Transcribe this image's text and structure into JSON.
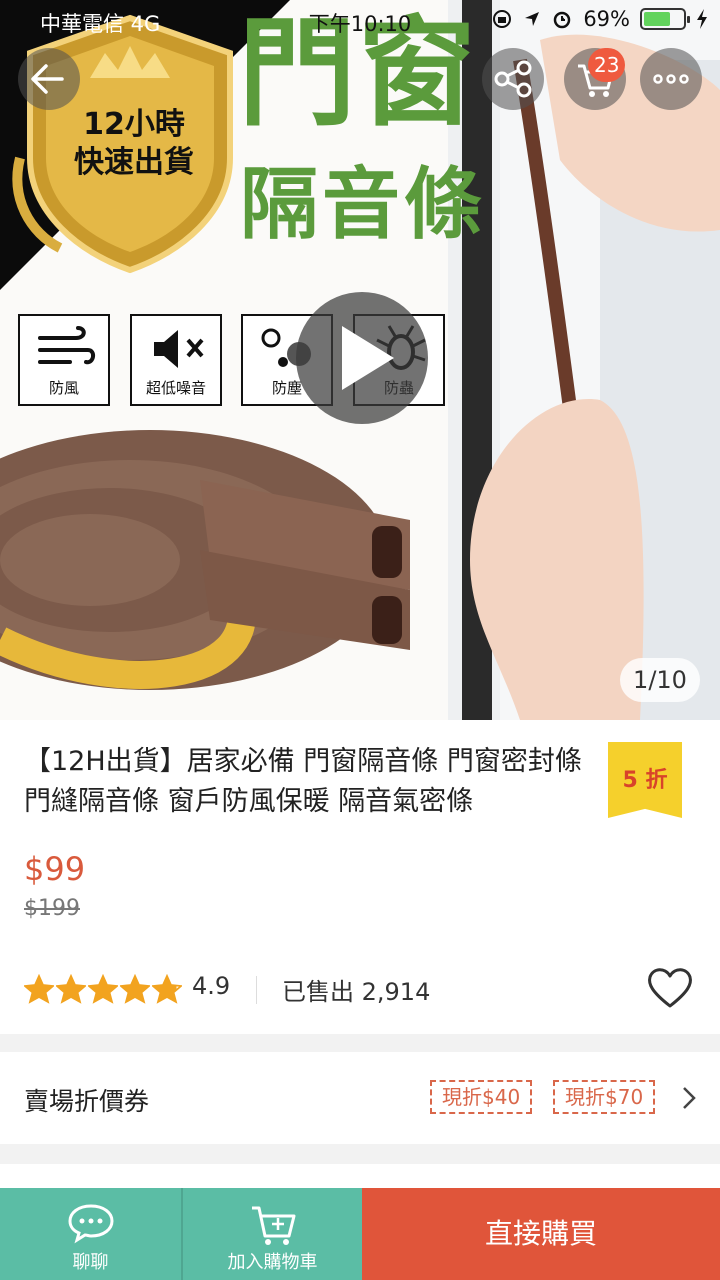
{
  "status_bar": {
    "carrier": "中華電信  4G",
    "time": "下午10:10",
    "battery": "69%",
    "battery_level": 0.69
  },
  "hero": {
    "title_line1": "門窗",
    "title_line2": "隔音條",
    "badge_line1": "12小時",
    "badge_line2": "快速出貨",
    "features": [
      "防風",
      "超低噪音",
      "防塵",
      "防蟲"
    ],
    "image_counter": "1/10",
    "cart_count": "23"
  },
  "product": {
    "title": "【12H出貨】居家必備 門窗隔音條 門窗密封條 門縫隔音條 窗戶防風保暖 隔音氣密條",
    "discount_tag": "5 折",
    "price": "$99",
    "original_price": "$199",
    "rating": "4.9",
    "stars": 4.9,
    "sold": "已售出 2,914"
  },
  "coupons": {
    "label": "賣場折價券",
    "items": [
      "現折$40",
      "現折$70"
    ]
  },
  "bottom_bar": {
    "chat": "聊聊",
    "add_cart": "加入購物車",
    "buy_now": "直接購買"
  },
  "colors": {
    "accent_green": "#5bbda5",
    "buy_red": "#e0553a",
    "price_red": "#d95a3c",
    "title_green": "#5b9b3c",
    "tag_yellow": "#f5d02c"
  }
}
